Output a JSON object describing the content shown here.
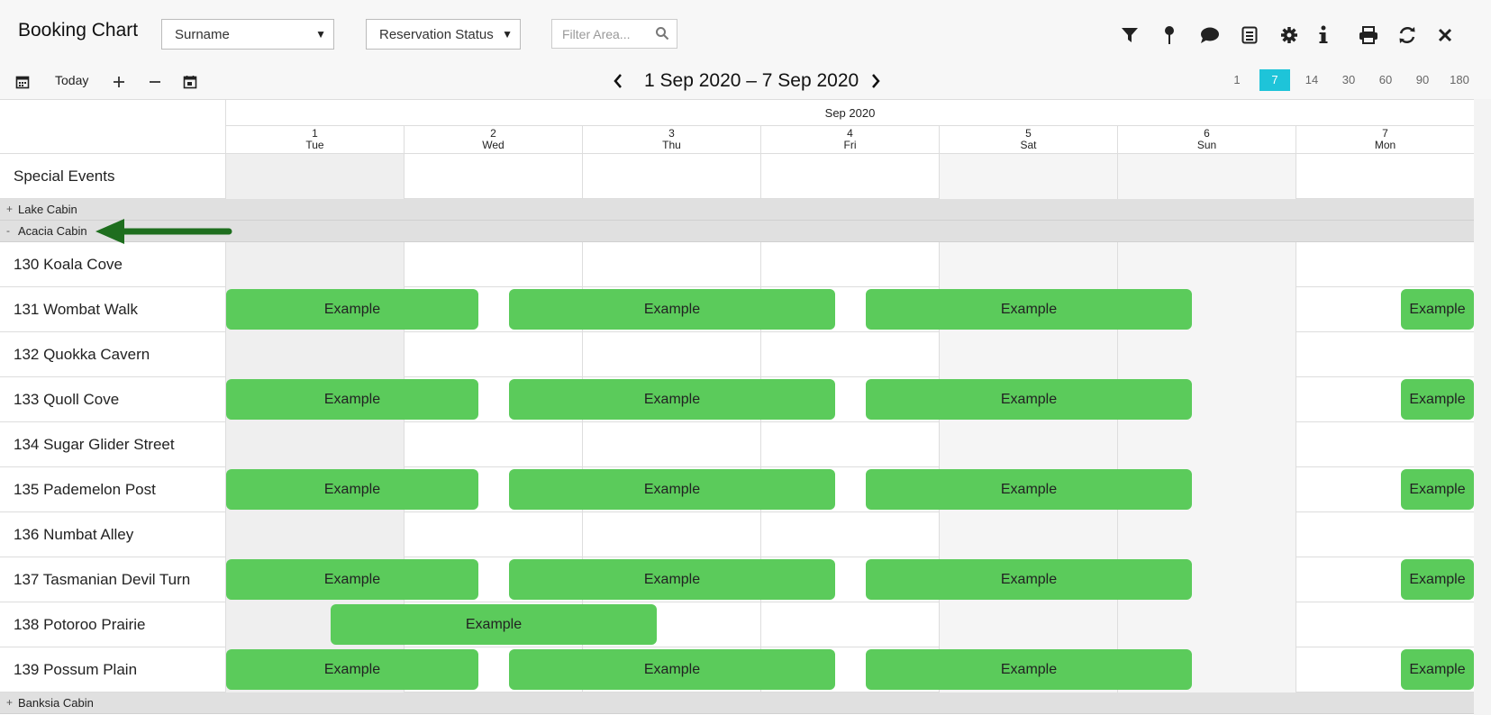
{
  "header": {
    "title": "Booking Chart",
    "sort_select": "Surname",
    "status_select": "Reservation Status",
    "filter_placeholder": "Filter Area..."
  },
  "toolbar_icons": [
    "filter-icon",
    "pin-icon",
    "comment-icon",
    "report-icon",
    "gear-icon",
    "info-icon",
    "print-icon",
    "refresh-icon",
    "close-icon"
  ],
  "nav": {
    "today_label": "Today",
    "date_range": "1 Sep 2020 – 7 Sep 2020",
    "spans": [
      "1",
      "7",
      "14",
      "30",
      "60",
      "90",
      "180"
    ],
    "active_span": "7"
  },
  "grid": {
    "month": "Sep 2020",
    "days": [
      {
        "num": "1",
        "dow": "Tue"
      },
      {
        "num": "2",
        "dow": "Wed"
      },
      {
        "num": "3",
        "dow": "Thu"
      },
      {
        "num": "4",
        "dow": "Fri"
      },
      {
        "num": "5",
        "dow": "Sat"
      },
      {
        "num": "6",
        "dow": "Sun"
      },
      {
        "num": "7",
        "dow": "Mon"
      }
    ],
    "special_events": "Special Events",
    "groups": {
      "lake": {
        "sign": "+",
        "label": "Lake Cabin"
      },
      "acacia": {
        "sign": "-",
        "label": "Acacia Cabin"
      },
      "banksia": {
        "sign": "+",
        "label": "Banksia Cabin"
      }
    },
    "rooms": [
      "130 Koala Cove",
      "131 Wombat Walk",
      "132 Quokka Cavern",
      "133 Quoll Cove",
      "134 Sugar Glider Street",
      "135 Pademelon Post",
      "136 Numbat Alley",
      "137 Tasmanian Devil Turn",
      "138 Potoroo Prairie",
      "139 Possum Plain"
    ],
    "booking_label": "Example"
  },
  "colors": {
    "booking": "#5bcb5b",
    "active_span": "#1ec4d9",
    "arrow": "#1e6e1e"
  }
}
